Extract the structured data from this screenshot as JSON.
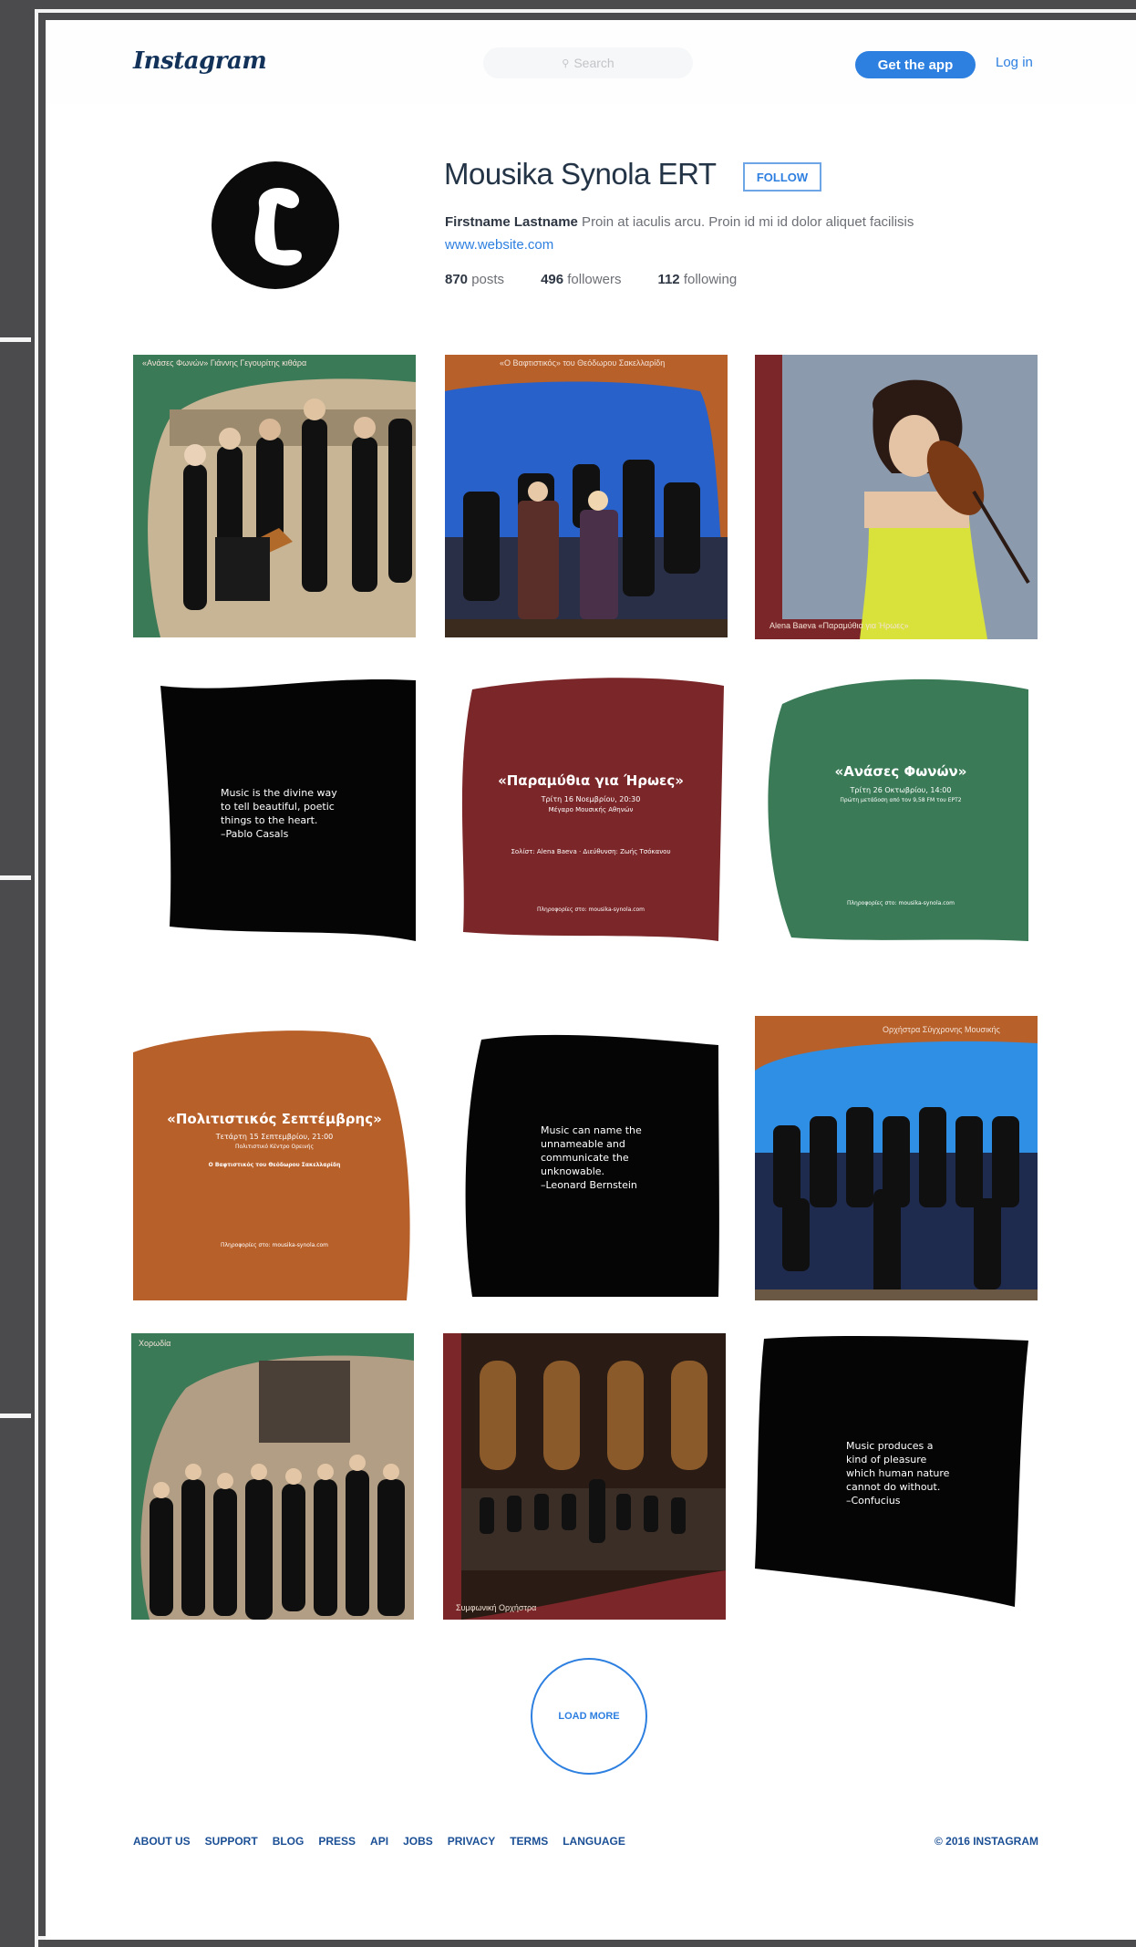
{
  "header": {
    "logo": "Instagram",
    "search_placeholder": "Search",
    "get_app_label": "Get the app",
    "login_label": "Log in"
  },
  "profile": {
    "name": "Mousika Synola ERT",
    "follow_label": "FOLLOW",
    "bio_name": "Firstname Lastname",
    "bio_text": " Proin at iaculis arcu. Proin id mi id dolor aliquet facilisis",
    "website": "www.website.com",
    "posts_count": "870",
    "posts_label": " posts",
    "followers_count": "496",
    "followers_label": " followers",
    "following_count": "112",
    "following_label": " following"
  },
  "posts": [
    {
      "caption": "«Ανάσες Φωνών» Γιάννης Γεγουρίτης κιθάρα"
    },
    {
      "caption": "«Ο Βαφτιστικός» του Θεόδωρου Σακελλαρίδη"
    },
    {
      "caption": "Alena Baeva «Παραμύθια για Ήρωες»"
    },
    {
      "quote": "Music is the divine way to tell beautiful, poetic things to the heart.",
      "author": "–Pablo Casals"
    },
    {
      "title": "«Παραμύθια για Ήρωες»",
      "line1": "Τρίτη 16 Νοεμβρίου, 20:30",
      "line2": "Μέγαρο Μουσικής Αθηνών",
      "line3": "Σολίστ: Alena Baeva · Διεύθυνση: Ζωής Τσόκανου",
      "line4": "Πληροφορίες στο: mousika-synola.com"
    },
    {
      "title": "«Ανάσες Φωνών»",
      "line1": "Τρίτη 26 Οκτωβρίου, 14:00",
      "line2": "Πρώτη μετάδοση από τον 9,58 FM του ΕΡΤ2",
      "line3": "Πληροφορίες στο: mousika-synola.com"
    },
    {
      "title": "«Πολιτιστικός Σεπτέμβρης»",
      "line1": "Τετάρτη 15 Σεπτεμβρίου, 21:00",
      "line2": "Πολιτιστικό Κέντρο Ορεινής",
      "line3": "Ο Βαφτιστικός του Θεόδωρου Σακελλαρίδη",
      "line4": "Πληροφορίες στο: mousika-synola.com"
    },
    {
      "quote": "Music can name the unnameable and communicate the unknowable.",
      "author": "–Leonard Bernstein"
    },
    {
      "caption": "Ορχήστρα Σύγχρονης Μουσικής"
    },
    {
      "caption": "Χορωδία"
    },
    {
      "caption": "Συμφωνική Ορχήστρα"
    },
    {
      "quote": "Music produces a kind of pleasure which human nature cannot do without.",
      "author": "–Confucius"
    }
  ],
  "load_more_label": "LOAD MORE",
  "footer": {
    "links": [
      "ABOUT US",
      "SUPPORT",
      "BLOG",
      "PRESS",
      "API",
      "JOBS",
      "PRIVACY",
      "TERMS",
      "LANGUAGE"
    ],
    "copyright": "© 2016 INSTAGRAM"
  },
  "colors": {
    "accent_blue": "#2d7fe0",
    "green": "#3a7a57",
    "orange": "#b8602a",
    "maroon": "#7b2628",
    "black": "#050505"
  }
}
